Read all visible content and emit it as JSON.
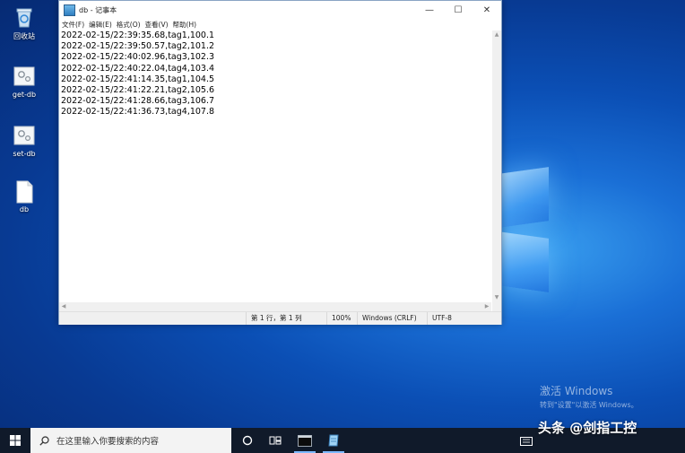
{
  "desktop": {
    "icons": [
      {
        "label": "回收站",
        "icon": "recycle-bin-icon"
      },
      {
        "label": "get-db",
        "icon": "script-file-icon"
      },
      {
        "label": "set-db",
        "icon": "script-file-icon"
      },
      {
        "label": "db",
        "icon": "text-file-icon"
      }
    ]
  },
  "notepad": {
    "title": "db - 记事本",
    "controls": {
      "minimize": "—",
      "maximize": "☐",
      "close": "✕"
    },
    "menu": [
      "文件(F)",
      "编辑(E)",
      "格式(O)",
      "查看(V)",
      "帮助(H)"
    ],
    "lines": [
      "2022-02-15/22:39:35.68,tag1,100.1",
      "2022-02-15/22:39:50.57,tag2,101.2",
      "2022-02-15/22:40:02.96,tag3,102.3",
      "2022-02-15/22:40:22.04,tag4,103.4",
      "2022-02-15/22:41:14.35,tag1,104.5",
      "2022-02-15/22:41:22.21,tag2,105.6",
      "2022-02-15/22:41:28.66,tag3,106.7",
      "2022-02-15/22:41:36.73,tag4,107.8"
    ],
    "status": {
      "position": "第 1 行，第 1 列",
      "zoom": "100%",
      "line_ending": "Windows (CRLF)",
      "encoding": "UTF-8"
    }
  },
  "activate_windows": {
    "title": "激活 Windows",
    "subtitle": "转到\"设置\"以激活 Windows。"
  },
  "taskbar": {
    "search_placeholder": "在这里输入你要搜索的内容",
    "buttons": [
      "cortana-circle-icon",
      "task-view-icon",
      "terminal-icon",
      "notepad-icon"
    ]
  },
  "watermark": {
    "text": "头条 @剑指工控"
  },
  "colors": {
    "desktop_blue": "#0b4fb5",
    "taskbar": "#101a2a",
    "active_indicator": "#7db8ff"
  }
}
